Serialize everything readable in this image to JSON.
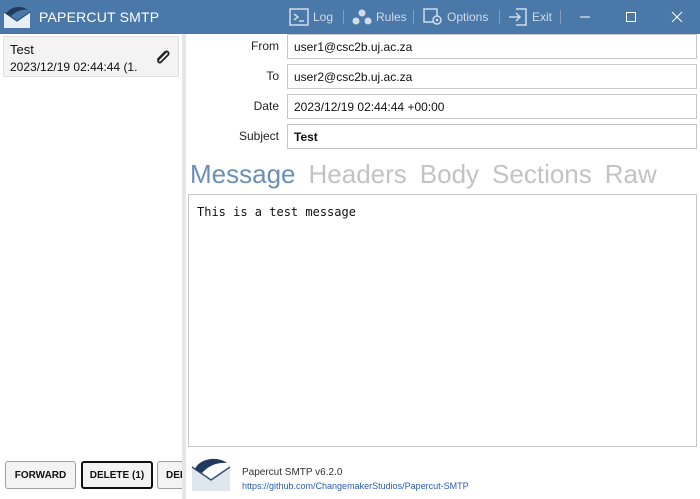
{
  "window": {
    "title": "PAPERCUT SMTP",
    "toolbar": [
      {
        "label": "Log",
        "icon": "terminal-icon"
      },
      {
        "label": "Rules",
        "icon": "rules-icon"
      },
      {
        "label": "Options",
        "icon": "options-icon"
      },
      {
        "label": "Exit",
        "icon": "exit-icon"
      }
    ],
    "controls": [
      "minimize-icon",
      "maximize-icon",
      "close-icon"
    ],
    "colors": {
      "titlebar": "#4a78a8",
      "accent": "#6b8fb7"
    }
  },
  "messages": [
    {
      "subject": "Test",
      "date": "2023/12/19 02:44:44 (1.",
      "has_attachment": true
    }
  ],
  "actions": {
    "forward": "FORWARD",
    "delete": "DELETE (1)",
    "delete_all": "DELETE ALL"
  },
  "detail": {
    "from_label": "From",
    "from": "user1@csc2b.uj.ac.za",
    "to_label": "To",
    "to": "user2@csc2b.uj.ac.za",
    "date_label": "Date",
    "date": "2023/12/19 02:44:44 +00:00",
    "subject_label": "Subject",
    "subject": "Test"
  },
  "tabs": [
    {
      "label": "Message",
      "active": true
    },
    {
      "label": "Headers",
      "active": false
    },
    {
      "label": "Body",
      "active": false
    },
    {
      "label": "Sections",
      "active": false
    },
    {
      "label": "Raw",
      "active": false
    }
  ],
  "message_body": "This is a test message",
  "footer": {
    "version": "Papercut SMTP v6.2.0",
    "link": "https://github.com/ChangemakerStudios/Papercut-SMTP"
  }
}
